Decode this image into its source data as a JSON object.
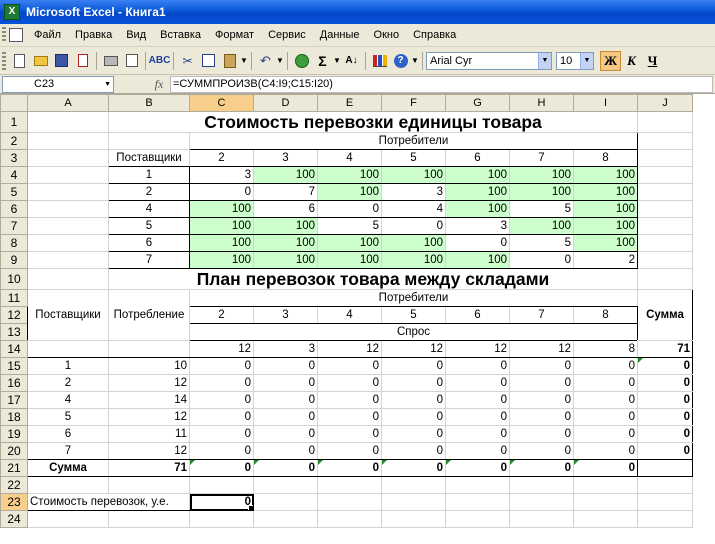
{
  "window": {
    "title": "Microsoft Excel - Книга1",
    "app_icon": "excel-icon"
  },
  "menu": [
    "Файл",
    "Правка",
    "Вид",
    "Вставка",
    "Формат",
    "Сервис",
    "Данные",
    "Окно",
    "Справка"
  ],
  "toolbar": {
    "font_name": "Arial Cyr",
    "font_size": "10",
    "bold_label": "Ж",
    "italic_label": "К",
    "underline_label": "Ч",
    "sum_label": "Σ"
  },
  "formula_bar": {
    "name_box": "C23",
    "fx_label": "fx",
    "formula": "=СУММПРОИЗВ(C4:I9;C15:I20)"
  },
  "colors": {
    "green_fill": "#ccffcc",
    "header_selected": "#f7cf8a"
  },
  "columns": [
    "A",
    "B",
    "C",
    "D",
    "E",
    "F",
    "G",
    "H",
    "I",
    "J"
  ],
  "rows": [
    "1",
    "2",
    "3",
    "4",
    "5",
    "6",
    "7",
    "8",
    "9",
    "10",
    "11",
    "12",
    "13",
    "14",
    "15",
    "16",
    "17",
    "18",
    "19",
    "20",
    "21",
    "22",
    "23",
    "24"
  ],
  "table1": {
    "title": "Стоимость перевозки единицы товара",
    "consumers_label": "Потребители",
    "suppliers_label": "Поставщики",
    "consumer_ids": [
      "2",
      "3",
      "4",
      "5",
      "6",
      "7",
      "8"
    ],
    "rows": [
      {
        "supplier": "1",
        "values": [
          "3",
          "100",
          "100",
          "100",
          "100",
          "100",
          "100"
        ]
      },
      {
        "supplier": "2",
        "values": [
          "0",
          "7",
          "100",
          "3",
          "100",
          "100",
          "100"
        ]
      },
      {
        "supplier": "4",
        "values": [
          "100",
          "6",
          "0",
          "4",
          "100",
          "5",
          "100"
        ]
      },
      {
        "supplier": "5",
        "values": [
          "100",
          "100",
          "5",
          "0",
          "3",
          "100",
          "100"
        ]
      },
      {
        "supplier": "6",
        "values": [
          "100",
          "100",
          "100",
          "100",
          "0",
          "5",
          "100"
        ]
      },
      {
        "supplier": "7",
        "values": [
          "100",
          "100",
          "100",
          "100",
          "100",
          "0",
          "2"
        ]
      }
    ]
  },
  "table2": {
    "title": "План перевозок товара между складами",
    "consumers_label": "Потребители",
    "suppliers_label": "Поставщики",
    "consumption_label": "Потребление",
    "sum_label": "Сумма",
    "demand_label": "Спрос",
    "consumer_ids": [
      "2",
      "3",
      "4",
      "5",
      "6",
      "7",
      "8"
    ],
    "demand": [
      "12",
      "3",
      "12",
      "12",
      "12",
      "12",
      "8"
    ],
    "demand_total": "71",
    "rows": [
      {
        "supplier": "1",
        "consumption": "10",
        "values": [
          "0",
          "0",
          "0",
          "0",
          "0",
          "0",
          "0"
        ],
        "sum": "0"
      },
      {
        "supplier": "2",
        "consumption": "12",
        "values": [
          "0",
          "0",
          "0",
          "0",
          "0",
          "0",
          "0"
        ],
        "sum": "0"
      },
      {
        "supplier": "4",
        "consumption": "14",
        "values": [
          "0",
          "0",
          "0",
          "0",
          "0",
          "0",
          "0"
        ],
        "sum": "0"
      },
      {
        "supplier": "5",
        "consumption": "12",
        "values": [
          "0",
          "0",
          "0",
          "0",
          "0",
          "0",
          "0"
        ],
        "sum": "0"
      },
      {
        "supplier": "6",
        "consumption": "11",
        "values": [
          "0",
          "0",
          "0",
          "0",
          "0",
          "0",
          "0"
        ],
        "sum": "0"
      },
      {
        "supplier": "7",
        "consumption": "12",
        "values": [
          "0",
          "0",
          "0",
          "0",
          "0",
          "0",
          "0"
        ],
        "sum": "0"
      }
    ],
    "total_label": "Сумма",
    "consumption_total": "71",
    "column_totals": [
      "0",
      "0",
      "0",
      "0",
      "0",
      "0",
      "0"
    ]
  },
  "cost_label": "Стоимость перевозок, у.е.",
  "cost_value": "0"
}
